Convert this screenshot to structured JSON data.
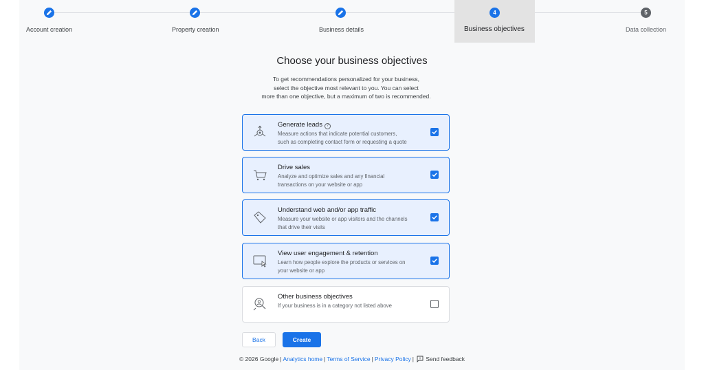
{
  "stepper": {
    "steps": [
      {
        "label": "Account creation",
        "state": "done"
      },
      {
        "label": "Property creation",
        "state": "done"
      },
      {
        "label": "Business details",
        "state": "done"
      },
      {
        "label": "Business objectives",
        "state": "active",
        "number": "4"
      },
      {
        "label": "Data collection",
        "state": "pending",
        "number": "5"
      }
    ]
  },
  "main": {
    "title": "Choose your business objectives",
    "subtitle_lines": [
      "To get recommendations personalized for your business,",
      "select the objective most relevant to you. You can select",
      "more than one objective, but a maximum of two is recommended."
    ],
    "objectives": [
      {
        "title": "Generate leads",
        "desc_lines": [
          "Measure actions that indicate potential customers,",
          "such as completing contact form or requesting a quote"
        ],
        "checked": true,
        "icon": "target-icon",
        "help": "?"
      },
      {
        "title": "Drive sales",
        "desc_lines": [
          "Analyze and optimize sales and any financial",
          "transactions on your website or app"
        ],
        "checked": true,
        "icon": "cart-icon"
      },
      {
        "title": "Understand web and/or app traffic",
        "desc_lines": [
          "Measure your website or app visitors and the channels",
          "that drive their visits"
        ],
        "checked": true,
        "icon": "tag-icon"
      },
      {
        "title": "View user engagement & retention",
        "desc_lines": [
          "Learn how people explore the products or services on",
          "your website or app"
        ],
        "checked": true,
        "icon": "screen-cursor-icon"
      },
      {
        "title": "Other business objectives",
        "desc_lines": [
          "If your business is in a category not listed above"
        ],
        "checked": false,
        "icon": "magnify-person-icon"
      }
    ]
  },
  "actions": {
    "back_label": "Back",
    "create_label": "Create"
  },
  "footer": {
    "copyright": "© 2026 Google",
    "links": [
      "Analytics home",
      "Terms of Service",
      "Privacy Policy"
    ],
    "feedback": "Send feedback"
  },
  "colors": {
    "accent": "#1a73e8",
    "selected_bg": "#e8f0fe",
    "active_step_bg": "#e3e3e3"
  }
}
